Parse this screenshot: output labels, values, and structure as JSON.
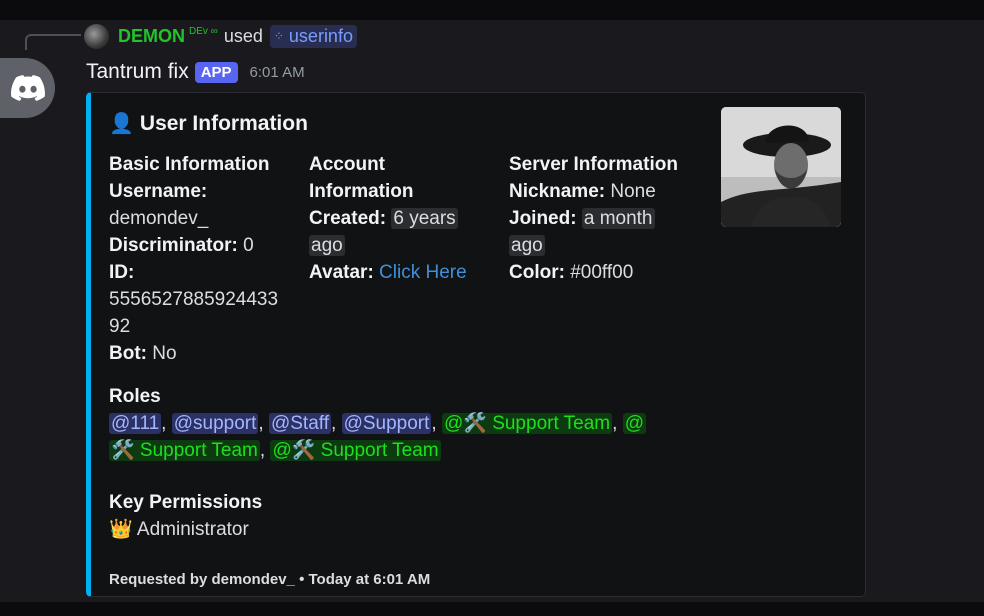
{
  "reply": {
    "user_name": "DEMON",
    "user_tag": "DEv ∞",
    "used_text": "used",
    "command": "userinfo",
    "avatar_icon": "demon-avatar-icon",
    "command_icon": "slash-command-icon"
  },
  "message": {
    "bot_name": "Tantrum fix",
    "badge": "APP",
    "timestamp": "6:01 AM",
    "bot_avatar_icon": "discord-logo-icon"
  },
  "embed": {
    "accent_color": "#00b0f4",
    "title_emoji": "👤",
    "title": "User Information",
    "basic": {
      "name": "Basic Information",
      "username_label": "Username:",
      "username": "demondev_",
      "discriminator_label": "Discriminator:",
      "discriminator": "0",
      "id_label": "ID:",
      "id_line1": "5556527885924433",
      "id_line2": "92",
      "bot_label": "Bot:",
      "bot": "No"
    },
    "account": {
      "name_line1": "Account",
      "name_line2": "Information",
      "created_label": "Created:",
      "created_line1": "6 years",
      "created_line2": "ago",
      "avatar_label": "Avatar:",
      "avatar_link": "Click Here"
    },
    "server": {
      "name": "Server Information",
      "nickname_label": "Nickname:",
      "nickname": "None",
      "joined_label": "Joined:",
      "joined_line1": "a month",
      "joined_line2": "ago",
      "color_label": "Color:",
      "color": "#00ff00"
    },
    "roles": {
      "name": "Roles",
      "list": [
        "@111",
        "@support",
        "@Staff",
        "@Support",
        "@🛠️ Support Team"
      ],
      "separator": ",",
      "wrapped_role_start": "@",
      "wrapped_role_end": "🛠️ Support Team",
      "last_role": "@🛠️ Support Team"
    },
    "permissions": {
      "name": "Key Permissions",
      "emoji": "👑",
      "value": "Administrator"
    },
    "footer": {
      "requested_by": "Requested by demondev_",
      "bullet": "•",
      "when": "Today at 6:01 AM"
    },
    "thumbnail_icon": "user-avatar-photo"
  }
}
